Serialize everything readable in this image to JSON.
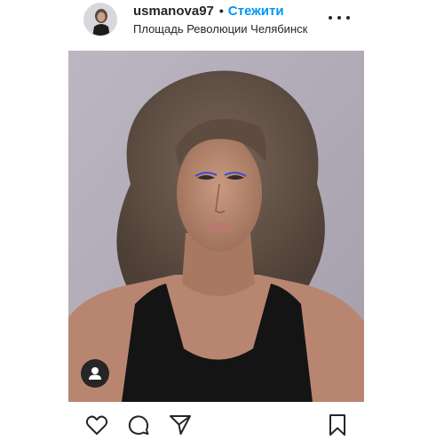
{
  "header": {
    "username": "usmanova97",
    "separator": "•",
    "follow_label": "Стежити",
    "location": "Площадь Революции Челябинск",
    "more_icon": "more-horizontal-icon"
  },
  "photo": {
    "tag_icon": "user-tag-icon"
  },
  "actions": {
    "like_icon": "heart-icon",
    "comment_icon": "comment-icon",
    "share_icon": "paper-plane-icon",
    "save_icon": "bookmark-icon"
  },
  "colors": {
    "accent": "#0095f6",
    "text": "#262626",
    "background": "#ffffff"
  }
}
